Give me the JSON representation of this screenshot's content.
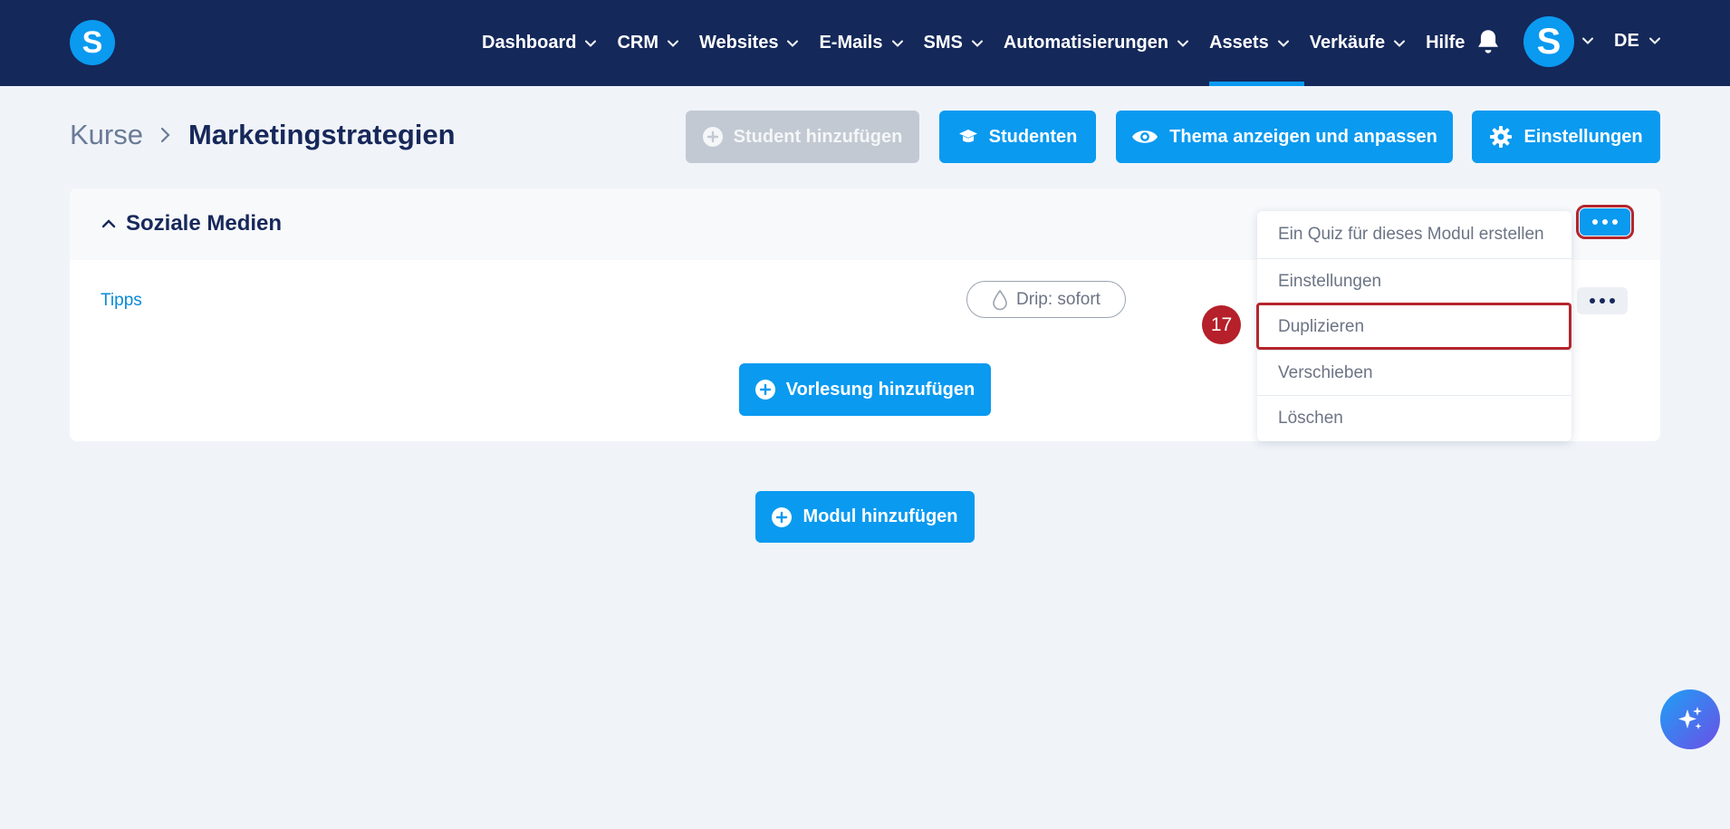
{
  "app": {
    "logo_letter": "S",
    "avatar_letter": "S",
    "accent": "#0a9af0",
    "nav_bg": "#14285a"
  },
  "nav": {
    "items": [
      {
        "label": "Dashboard",
        "has_dropdown": true
      },
      {
        "label": "CRM",
        "has_dropdown": true
      },
      {
        "label": "Websites",
        "has_dropdown": true
      },
      {
        "label": "E-Mails",
        "has_dropdown": true
      },
      {
        "label": "SMS",
        "has_dropdown": true
      },
      {
        "label": "Automatisierungen",
        "has_dropdown": true
      },
      {
        "label": "Assets",
        "has_dropdown": true,
        "active": true
      },
      {
        "label": "Verkäufe",
        "has_dropdown": true
      },
      {
        "label": "Hilfe",
        "has_dropdown": false
      }
    ],
    "language": "DE"
  },
  "breadcrumb": {
    "root": "Kurse",
    "current": "Marketingstrategien"
  },
  "toolbar": {
    "add_student": "Student hinzufügen",
    "students": "Studenten",
    "theme": "Thema anzeigen und anpassen",
    "settings": "Einstellungen"
  },
  "module": {
    "title": "Soziale Medien",
    "lecture": "Tipps",
    "drip": "Drip: sofort",
    "add_lecture": "Vorlesung hinzufügen"
  },
  "menu": {
    "items": [
      "Ein Quiz für dieses Modul erstellen",
      "Einstellungen",
      "Duplizieren",
      "Verschieben",
      "Löschen"
    ],
    "highlighted_index": 2
  },
  "annotation": {
    "step": "17",
    "color": "#b5202a"
  },
  "add_module": "Modul hinzufügen"
}
